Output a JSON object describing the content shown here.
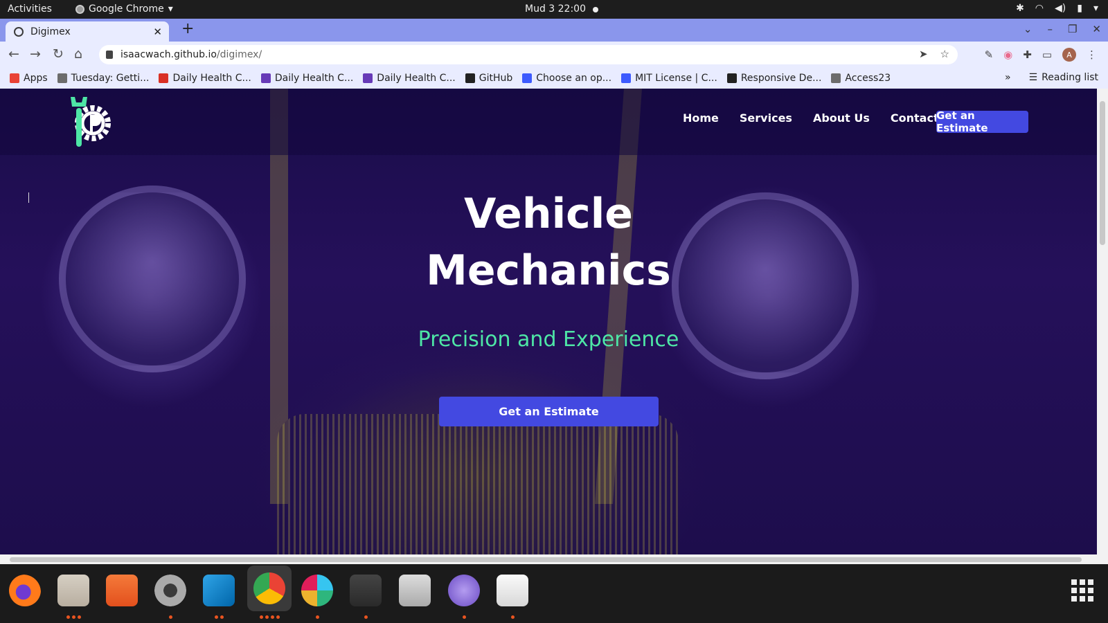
{
  "topbar": {
    "activities": "Activities",
    "app_name": "Google Chrome",
    "clock": "Mud 3  22:00"
  },
  "browser": {
    "tab_title": "Digimex",
    "url_host": "isaacwach.github.io",
    "url_path": "/digimex/",
    "profile_initial": "A",
    "bookmarks": [
      {
        "label": "Apps",
        "icon": "apps-grid-icon",
        "color": "#e94235"
      },
      {
        "label": "Tuesday: Getti...",
        "icon": "plant-icon",
        "color": "#6c6c6c"
      },
      {
        "label": "Daily Health C...",
        "icon": "gmail-icon",
        "color": "#d93025"
      },
      {
        "label": "Daily Health C...",
        "icon": "forms-icon",
        "color": "#673ab7"
      },
      {
        "label": "Daily Health C...",
        "icon": "forms-icon",
        "color": "#673ab7"
      },
      {
        "label": "GitHub",
        "icon": "github-icon",
        "color": "#222222"
      },
      {
        "label": "Choose an op...",
        "icon": "question-icon",
        "color": "#3d5afe"
      },
      {
        "label": "MIT License | C...",
        "icon": "question-icon",
        "color": "#3d5afe"
      },
      {
        "label": "Responsive De...",
        "icon": "globe-icon",
        "color": "#222222"
      },
      {
        "label": "Access23",
        "icon": "plant-icon",
        "color": "#6c6c6c"
      }
    ],
    "bookmarks_more": "»",
    "reading_list": "Reading list"
  },
  "site": {
    "nav": [
      "Home",
      "Services",
      "About Us",
      "Contact Us"
    ],
    "nav_cta": "Get an Estimate",
    "hero_title_line1": "Vehicle",
    "hero_title_line2": "Mechanics",
    "hero_subtitle": "Precision and Experience",
    "hero_cta": "Get an Estimate",
    "colors": {
      "brand": "#4349e1",
      "accent": "#4ee6a6",
      "background": "#1d0d4c"
    }
  },
  "dock": [
    {
      "name": "firefox-icon",
      "running": 0
    },
    {
      "name": "files-icon",
      "running": 3
    },
    {
      "name": "software-center-icon",
      "running": 0
    },
    {
      "name": "settings-icon",
      "running": 1
    },
    {
      "name": "vscode-icon",
      "running": 2
    },
    {
      "name": "chrome-icon",
      "running": 4
    },
    {
      "name": "slack-icon",
      "running": 1
    },
    {
      "name": "terminal-icon",
      "running": 1
    },
    {
      "name": "image-viewer-icon",
      "running": 0
    },
    {
      "name": "network-browser-icon",
      "running": 1
    },
    {
      "name": "text-editor-icon",
      "running": 1
    }
  ]
}
